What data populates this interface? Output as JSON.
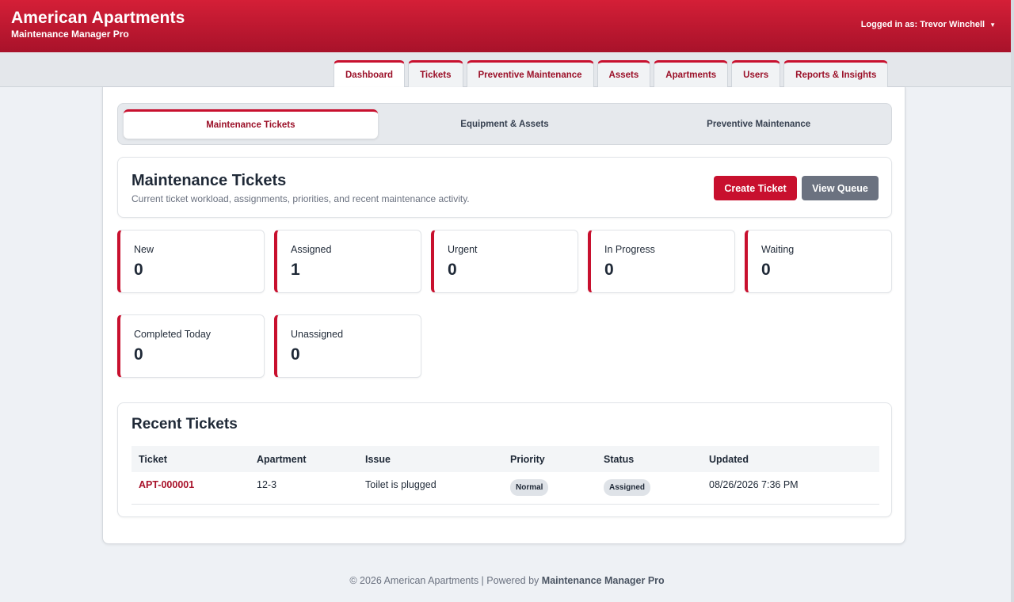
{
  "header": {
    "brand_title": "American Apartments",
    "brand_subtitle": "Maintenance Manager Pro",
    "user_label": "Logged in as: Trevor Winchell",
    "user_caret": "▼"
  },
  "nav": {
    "tabs": [
      {
        "label": "Dashboard",
        "active": true
      },
      {
        "label": "Tickets"
      },
      {
        "label": "Preventive Maintenance"
      },
      {
        "label": "Assets"
      },
      {
        "label": "Apartments"
      },
      {
        "label": "Users"
      },
      {
        "label": "Reports & Insights"
      }
    ]
  },
  "subtabs": [
    {
      "label": "Maintenance Tickets",
      "active": true
    },
    {
      "label": "Equipment & Assets"
    },
    {
      "label": "Preventive Maintenance"
    }
  ],
  "page": {
    "title": "Maintenance Tickets",
    "description": "Current ticket workload, assignments, priorities, and recent maintenance activity.",
    "create_button": "Create Ticket",
    "queue_button": "View Queue"
  },
  "stats": [
    {
      "label": "New",
      "value": "0"
    },
    {
      "label": "Assigned",
      "value": "1"
    },
    {
      "label": "Urgent",
      "value": "0"
    },
    {
      "label": "In Progress",
      "value": "0"
    },
    {
      "label": "Waiting",
      "value": "0"
    },
    {
      "label": "Completed Today",
      "value": "0"
    },
    {
      "label": "Unassigned",
      "value": "0"
    }
  ],
  "recent": {
    "title": "Recent Tickets",
    "columns": [
      "Ticket",
      "Apartment",
      "Issue",
      "Priority",
      "Status",
      "Updated"
    ],
    "rows": [
      {
        "ticket": "APT-000001",
        "apartment": "12-3",
        "issue": "Toilet is plugged",
        "priority": "Normal",
        "status": "Assigned",
        "updated": "08/26/2026 7:36 PM"
      }
    ]
  },
  "footer": {
    "text": "© 2026 American Apartments | Powered by",
    "brand": "Maintenance Manager Pro"
  },
  "colors": {
    "brand_red": "#c8102e",
    "secondary_gray": "#6b7280"
  }
}
